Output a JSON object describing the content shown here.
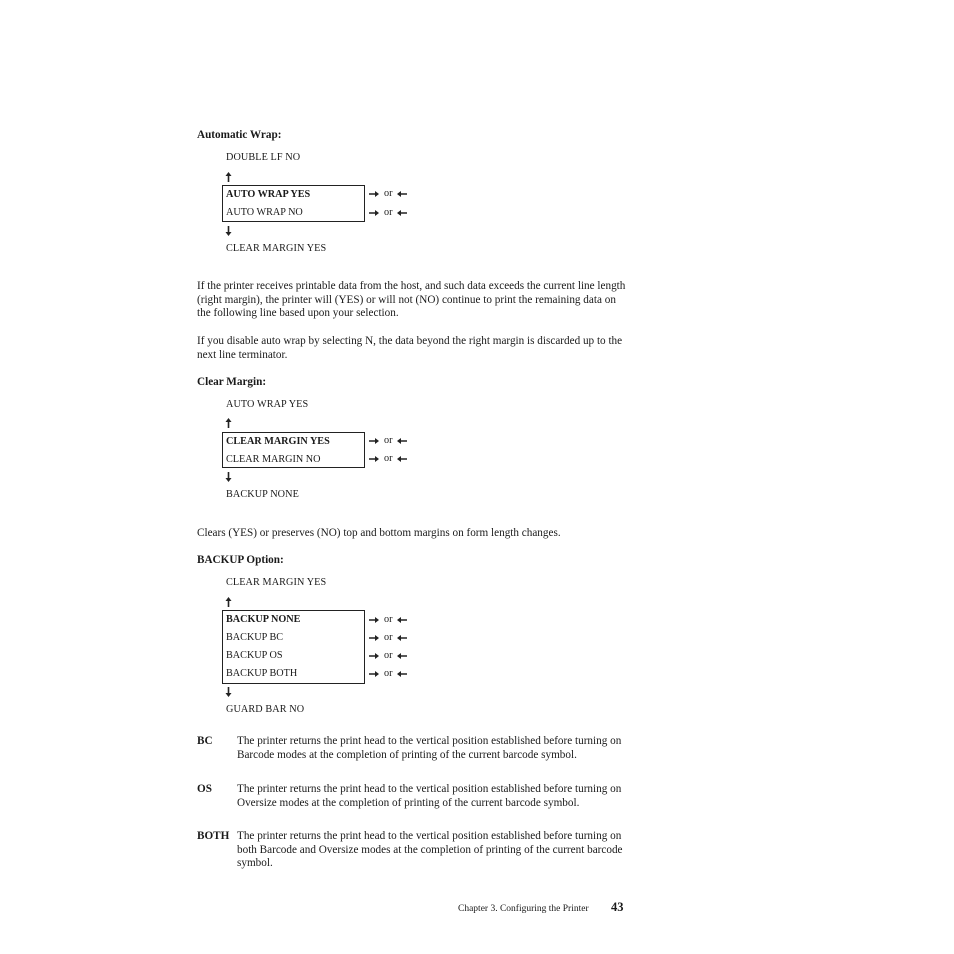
{
  "sections": {
    "auto_wrap": {
      "heading": "Automatic Wrap:",
      "prev_item": "DOUBLE LF NO",
      "options": [
        "AUTO WRAP YES",
        "AUTO WRAP NO"
      ],
      "next_item": "CLEAR MARGIN YES",
      "paragraphs": [
        "If the printer receives printable data from the host, and such data exceeds the current line length (right margin), the printer will (YES) or will not (NO) continue to print the remaining data on the following line based upon your selection.",
        "If you disable auto wrap by selecting N, the data beyond the right margin is discarded up to the next line terminator."
      ]
    },
    "clear_margin": {
      "heading": "Clear Margin:",
      "prev_item": "AUTO WRAP YES",
      "options": [
        "CLEAR MARGIN YES",
        "CLEAR MARGIN NO"
      ],
      "next_item": "BACKUP NONE",
      "paragraphs": [
        "Clears (YES) or preserves (NO) top and bottom margins on form length changes."
      ]
    },
    "backup": {
      "heading": "BACKUP Option:",
      "prev_item": "CLEAR MARGIN YES",
      "options": [
        "BACKUP NONE",
        "BACKUP BC",
        "BACKUP OS",
        "BACKUP BOTH"
      ],
      "next_item": "GUARD BAR NO",
      "definitions": [
        {
          "term": "BC",
          "text": "The printer returns the print head to the vertical position established before turning on Barcode modes at the completion of printing of the current barcode symbol."
        },
        {
          "term": "OS",
          "text": "The printer returns the print head to the vertical position established before turning on Oversize modes at the completion of printing of the current barcode symbol."
        },
        {
          "term": "BOTH",
          "text": "The printer returns the print head to the vertical position established before turning on both Barcode and Oversize modes at the completion of printing of the current barcode symbol."
        }
      ]
    }
  },
  "or_label": "or",
  "icons": {
    "up": "arrow-up-icon",
    "down": "arrow-down-icon",
    "right": "arrow-right-icon",
    "left": "arrow-left-icon"
  },
  "footer": {
    "chapter": "Chapter 3. Configuring the Printer",
    "page_number": "43"
  }
}
